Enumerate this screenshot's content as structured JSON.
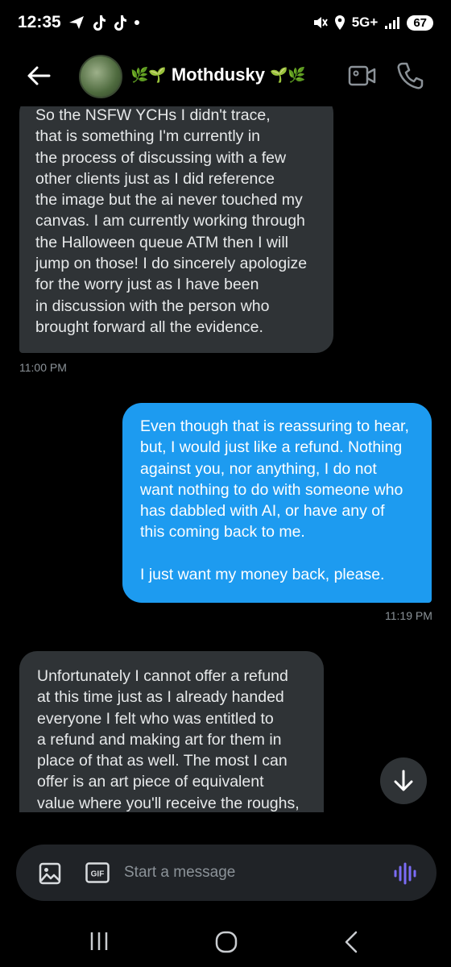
{
  "status_bar": {
    "time": "12:35",
    "network": "5G+",
    "battery": "67",
    "icons": [
      "send-icon",
      "tiktok-icon",
      "tiktok-icon",
      "dot-icon",
      "mute-icon",
      "location-icon",
      "signal-icon",
      "battery-icon"
    ]
  },
  "header": {
    "contact_name": "Mothdusky",
    "name_decor_left": "🌿🌱",
    "name_decor_right": "🌱🌿",
    "icons": [
      "back-arrow-icon",
      "video-call-icon",
      "phone-icon"
    ]
  },
  "messages": [
    {
      "direction": "received",
      "text": "So the NSFW YCHs I didn't trace,\nthat is something I'm currently in\nthe process of discussing with a few\nother clients just as I did reference\nthe image but the ai never touched my\ncanvas. I am currently working through\nthe Halloween queue ATM then I will\njump on those! I do sincerely apologize\nfor the worry just as I have been\nin discussion with the person who\nbrought forward all the evidence.",
      "time": "11:00 PM"
    },
    {
      "direction": "sent",
      "text": "Even though that is reassuring to hear,\nbut, I would just like a refund. Nothing\nagainst you, nor anything, I do not\nwant nothing to do with someone who\nhas dabbled with AI, or have any of\nthis coming back to me.\n\nI just want my money back, please.",
      "time": "11:19 PM"
    },
    {
      "direction": "received",
      "text": "Unfortunately I cannot offer a refund\nat this time just as I already handed\neveryone I felt who was entitled to\na refund and making art for them in\nplace of that as well. The most I can\noffer is an art piece of equivalent\nvalue where you'll receive the roughs,\nsketch, all the way to finish.",
      "time": ""
    }
  ],
  "composer": {
    "placeholder": "Start a message",
    "gif_label": "GIF"
  },
  "colors": {
    "background": "#000000",
    "received_bubble": "#2f3336",
    "sent_bubble": "#1d9bf0",
    "voice_accent": "#7b6cf6"
  }
}
